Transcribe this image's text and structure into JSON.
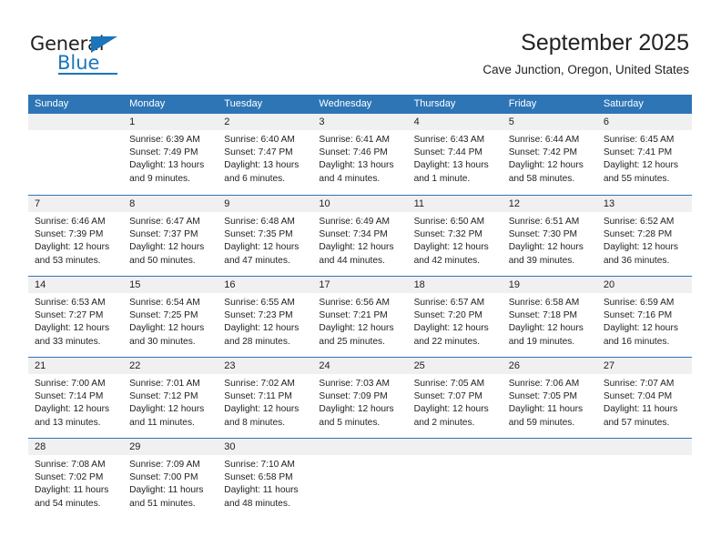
{
  "brand": {
    "name_part1": "General",
    "name_part2": "Blue",
    "accent_color": "#1b75bb"
  },
  "header": {
    "title": "September 2025",
    "subtitle": "Cave Junction, Oregon, United States"
  },
  "calendar": {
    "header_color": "#2e75b6",
    "weekdays": [
      "Sunday",
      "Monday",
      "Tuesday",
      "Wednesday",
      "Thursday",
      "Friday",
      "Saturday"
    ],
    "weeks": [
      [
        {
          "day": "",
          "lines": []
        },
        {
          "day": "1",
          "lines": [
            "Sunrise: 6:39 AM",
            "Sunset: 7:49 PM",
            "Daylight: 13 hours",
            "and 9 minutes."
          ]
        },
        {
          "day": "2",
          "lines": [
            "Sunrise: 6:40 AM",
            "Sunset: 7:47 PM",
            "Daylight: 13 hours",
            "and 6 minutes."
          ]
        },
        {
          "day": "3",
          "lines": [
            "Sunrise: 6:41 AM",
            "Sunset: 7:46 PM",
            "Daylight: 13 hours",
            "and 4 minutes."
          ]
        },
        {
          "day": "4",
          "lines": [
            "Sunrise: 6:43 AM",
            "Sunset: 7:44 PM",
            "Daylight: 13 hours",
            "and 1 minute."
          ]
        },
        {
          "day": "5",
          "lines": [
            "Sunrise: 6:44 AM",
            "Sunset: 7:42 PM",
            "Daylight: 12 hours",
            "and 58 minutes."
          ]
        },
        {
          "day": "6",
          "lines": [
            "Sunrise: 6:45 AM",
            "Sunset: 7:41 PM",
            "Daylight: 12 hours",
            "and 55 minutes."
          ]
        }
      ],
      [
        {
          "day": "7",
          "lines": [
            "Sunrise: 6:46 AM",
            "Sunset: 7:39 PM",
            "Daylight: 12 hours",
            "and 53 minutes."
          ]
        },
        {
          "day": "8",
          "lines": [
            "Sunrise: 6:47 AM",
            "Sunset: 7:37 PM",
            "Daylight: 12 hours",
            "and 50 minutes."
          ]
        },
        {
          "day": "9",
          "lines": [
            "Sunrise: 6:48 AM",
            "Sunset: 7:35 PM",
            "Daylight: 12 hours",
            "and 47 minutes."
          ]
        },
        {
          "day": "10",
          "lines": [
            "Sunrise: 6:49 AM",
            "Sunset: 7:34 PM",
            "Daylight: 12 hours",
            "and 44 minutes."
          ]
        },
        {
          "day": "11",
          "lines": [
            "Sunrise: 6:50 AM",
            "Sunset: 7:32 PM",
            "Daylight: 12 hours",
            "and 42 minutes."
          ]
        },
        {
          "day": "12",
          "lines": [
            "Sunrise: 6:51 AM",
            "Sunset: 7:30 PM",
            "Daylight: 12 hours",
            "and 39 minutes."
          ]
        },
        {
          "day": "13",
          "lines": [
            "Sunrise: 6:52 AM",
            "Sunset: 7:28 PM",
            "Daylight: 12 hours",
            "and 36 minutes."
          ]
        }
      ],
      [
        {
          "day": "14",
          "lines": [
            "Sunrise: 6:53 AM",
            "Sunset: 7:27 PM",
            "Daylight: 12 hours",
            "and 33 minutes."
          ]
        },
        {
          "day": "15",
          "lines": [
            "Sunrise: 6:54 AM",
            "Sunset: 7:25 PM",
            "Daylight: 12 hours",
            "and 30 minutes."
          ]
        },
        {
          "day": "16",
          "lines": [
            "Sunrise: 6:55 AM",
            "Sunset: 7:23 PM",
            "Daylight: 12 hours",
            "and 28 minutes."
          ]
        },
        {
          "day": "17",
          "lines": [
            "Sunrise: 6:56 AM",
            "Sunset: 7:21 PM",
            "Daylight: 12 hours",
            "and 25 minutes."
          ]
        },
        {
          "day": "18",
          "lines": [
            "Sunrise: 6:57 AM",
            "Sunset: 7:20 PM",
            "Daylight: 12 hours",
            "and 22 minutes."
          ]
        },
        {
          "day": "19",
          "lines": [
            "Sunrise: 6:58 AM",
            "Sunset: 7:18 PM",
            "Daylight: 12 hours",
            "and 19 minutes."
          ]
        },
        {
          "day": "20",
          "lines": [
            "Sunrise: 6:59 AM",
            "Sunset: 7:16 PM",
            "Daylight: 12 hours",
            "and 16 minutes."
          ]
        }
      ],
      [
        {
          "day": "21",
          "lines": [
            "Sunrise: 7:00 AM",
            "Sunset: 7:14 PM",
            "Daylight: 12 hours",
            "and 13 minutes."
          ]
        },
        {
          "day": "22",
          "lines": [
            "Sunrise: 7:01 AM",
            "Sunset: 7:12 PM",
            "Daylight: 12 hours",
            "and 11 minutes."
          ]
        },
        {
          "day": "23",
          "lines": [
            "Sunrise: 7:02 AM",
            "Sunset: 7:11 PM",
            "Daylight: 12 hours",
            "and 8 minutes."
          ]
        },
        {
          "day": "24",
          "lines": [
            "Sunrise: 7:03 AM",
            "Sunset: 7:09 PM",
            "Daylight: 12 hours",
            "and 5 minutes."
          ]
        },
        {
          "day": "25",
          "lines": [
            "Sunrise: 7:05 AM",
            "Sunset: 7:07 PM",
            "Daylight: 12 hours",
            "and 2 minutes."
          ]
        },
        {
          "day": "26",
          "lines": [
            "Sunrise: 7:06 AM",
            "Sunset: 7:05 PM",
            "Daylight: 11 hours",
            "and 59 minutes."
          ]
        },
        {
          "day": "27",
          "lines": [
            "Sunrise: 7:07 AM",
            "Sunset: 7:04 PM",
            "Daylight: 11 hours",
            "and 57 minutes."
          ]
        }
      ],
      [
        {
          "day": "28",
          "lines": [
            "Sunrise: 7:08 AM",
            "Sunset: 7:02 PM",
            "Daylight: 11 hours",
            "and 54 minutes."
          ]
        },
        {
          "day": "29",
          "lines": [
            "Sunrise: 7:09 AM",
            "Sunset: 7:00 PM",
            "Daylight: 11 hours",
            "and 51 minutes."
          ]
        },
        {
          "day": "30",
          "lines": [
            "Sunrise: 7:10 AM",
            "Sunset: 6:58 PM",
            "Daylight: 11 hours",
            "and 48 minutes."
          ]
        },
        {
          "day": "",
          "lines": []
        },
        {
          "day": "",
          "lines": []
        },
        {
          "day": "",
          "lines": []
        },
        {
          "day": "",
          "lines": []
        }
      ]
    ]
  }
}
